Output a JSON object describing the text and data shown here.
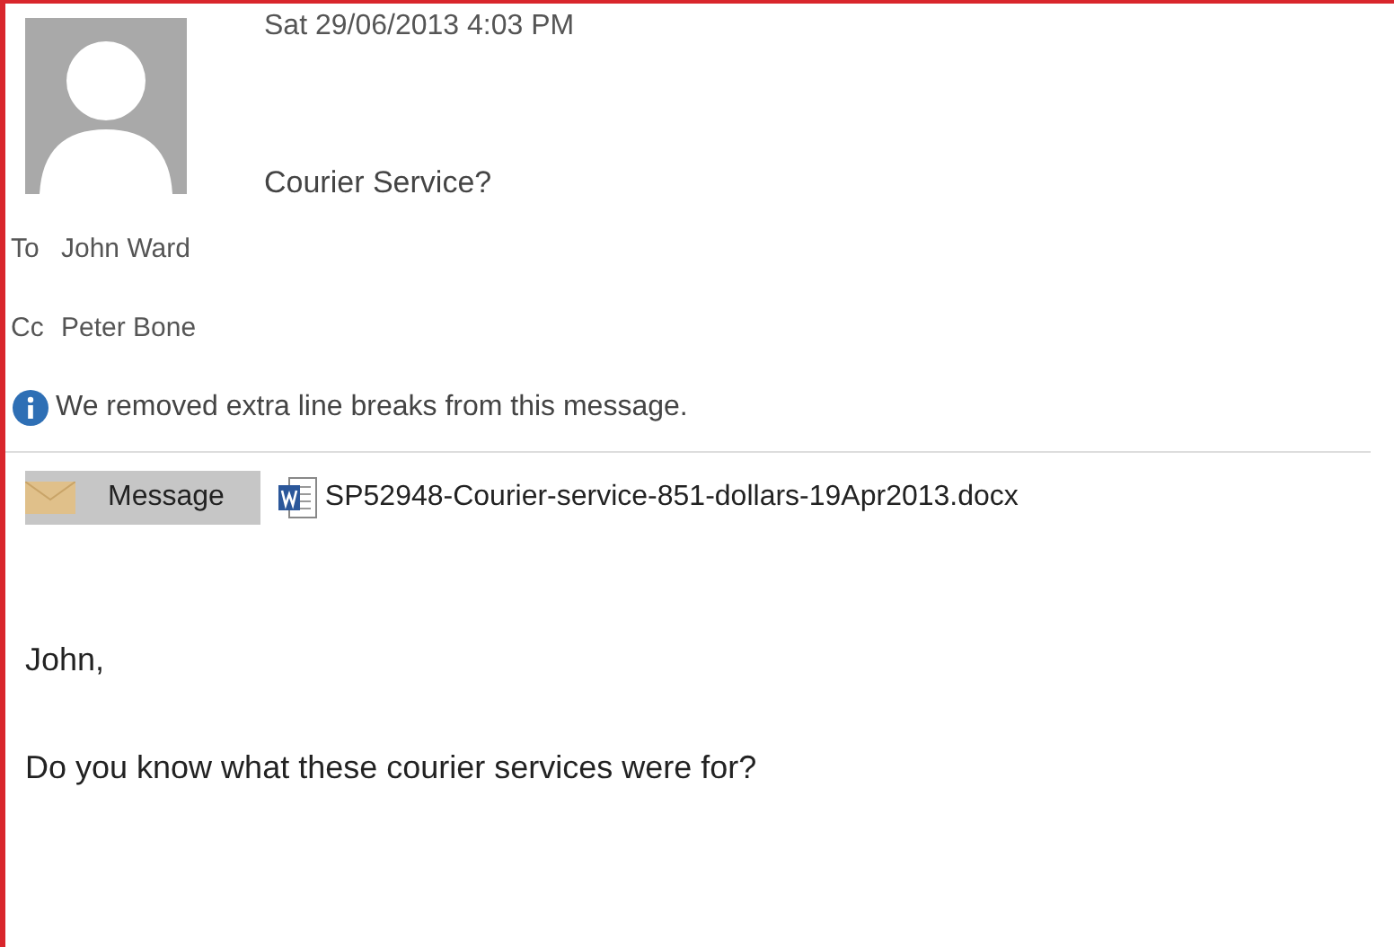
{
  "header": {
    "date": "Sat 29/06/2013 4:03 PM",
    "subject": "Courier Service?"
  },
  "recipients": [
    {
      "label": "To",
      "name": "John Ward"
    },
    {
      "label": "Cc",
      "name": "Peter Bone"
    }
  ],
  "info_bar": {
    "text": "We removed extra line breaks from this message."
  },
  "attachments": [
    {
      "kind": "message",
      "label": "Message",
      "selected": true
    },
    {
      "kind": "document",
      "label": "SP52948-Courier-service-851-dollars-19Apr2013.docx",
      "selected": false
    }
  ],
  "body": [
    "John,",
    "Do you know what these courier services were for?"
  ]
}
